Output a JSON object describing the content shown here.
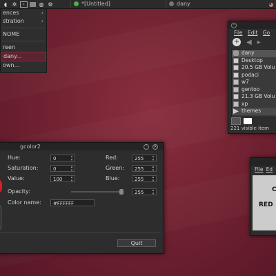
{
  "panel": {
    "tasks": [
      {
        "label": "*[Untitled]",
        "dot": "#4caf50"
      },
      {
        "label": "dany",
        "dot": "#777777"
      }
    ]
  },
  "menu": {
    "items": [
      "ences",
      "stration",
      "NOME",
      "reen",
      "dany...",
      "own..."
    ]
  },
  "file_manager": {
    "menu": [
      "File",
      "Edit",
      "Go"
    ],
    "items": [
      {
        "label": "dany",
        "icon": "home-icon"
      },
      {
        "label": "Desktop",
        "icon": "desktop-icon"
      },
      {
        "label": "20.5 GB Volu",
        "icon": "drive-icon"
      },
      {
        "label": "podaci",
        "icon": "drive-icon"
      },
      {
        "label": "w7",
        "icon": "folder-icon"
      },
      {
        "label": "gentoo",
        "icon": "folder-icon"
      },
      {
        "label": "21.3 GB Volu",
        "icon": "drive-icon"
      },
      {
        "label": "xp",
        "icon": "folder-icon"
      },
      {
        "label": "themes",
        "icon": "triangle-icon"
      }
    ],
    "status": "221 visible item"
  },
  "gcolor": {
    "title": "gcolor2",
    "hue": {
      "label": "Hue:",
      "value": "0"
    },
    "saturation": {
      "label": "Saturation:",
      "value": "0"
    },
    "value": {
      "label": "Value:",
      "value": "100"
    },
    "red": {
      "label": "Red:",
      "value": "255"
    },
    "green": {
      "label": "Green:",
      "value": "255"
    },
    "blue": {
      "label": "Blue:",
      "value": "255"
    },
    "opacity": {
      "label": "Opacity:",
      "value": "255"
    },
    "color_name": {
      "label": "Color name:",
      "value": "#FFFFFF"
    },
    "quit": "Quit"
  },
  "right_window": {
    "menu": [
      "File",
      "Ed"
    ],
    "text1": "C",
    "text2": "RED"
  },
  "colors": {
    "accent": "#7b3040",
    "background": "#6e2030"
  }
}
